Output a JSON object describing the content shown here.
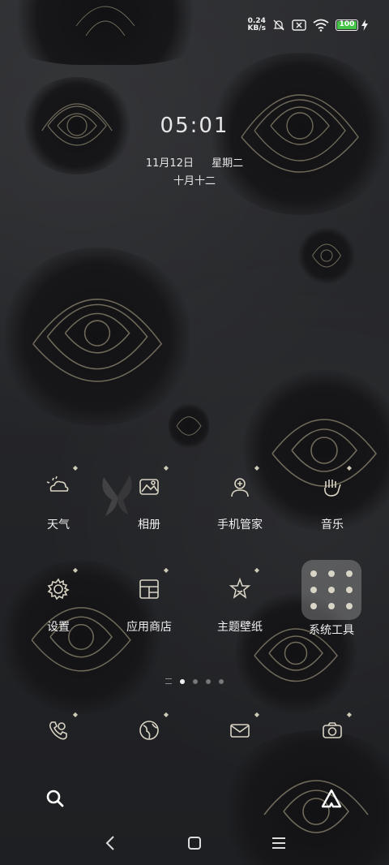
{
  "status_bar": {
    "net_speed_value": "0.24",
    "net_speed_unit": "KB/s",
    "battery_level": "100",
    "icons": [
      "mute-bell-icon",
      "no-sim-icon",
      "wifi-icon",
      "battery-icon",
      "charging-icon"
    ]
  },
  "clock": {
    "time": "05:01",
    "date": "11月12日",
    "weekday": "星期二",
    "lunar": "十月十二"
  },
  "apps": [
    {
      "label": "天气",
      "icon": "weather-icon"
    },
    {
      "label": "相册",
      "icon": "gallery-icon"
    },
    {
      "label": "手机管家",
      "icon": "security-icon"
    },
    {
      "label": "音乐",
      "icon": "music-icon"
    },
    {
      "label": "设置",
      "icon": "settings-icon"
    },
    {
      "label": "应用商店",
      "icon": "app-store-icon"
    },
    {
      "label": "主题壁纸",
      "icon": "themes-icon"
    },
    {
      "label": "系统工具",
      "icon": "folder-icon"
    }
  ],
  "page_indicator": {
    "pages": 4,
    "active": 0
  },
  "dock": [
    {
      "icon": "phone-icon"
    },
    {
      "icon": "browser-icon"
    },
    {
      "icon": "messages-icon"
    },
    {
      "icon": "camera-icon"
    }
  ],
  "bottom_bar": {
    "left_icon": "search-icon",
    "right_icon": "assistant-icon"
  },
  "nav_bar": {
    "buttons": [
      "back-icon",
      "home-icon",
      "recents-icon"
    ]
  },
  "colors": {
    "icon_line": "#d9d4c4",
    "active_dot": "#f0f0f0",
    "battery_fill": "#43c447"
  }
}
